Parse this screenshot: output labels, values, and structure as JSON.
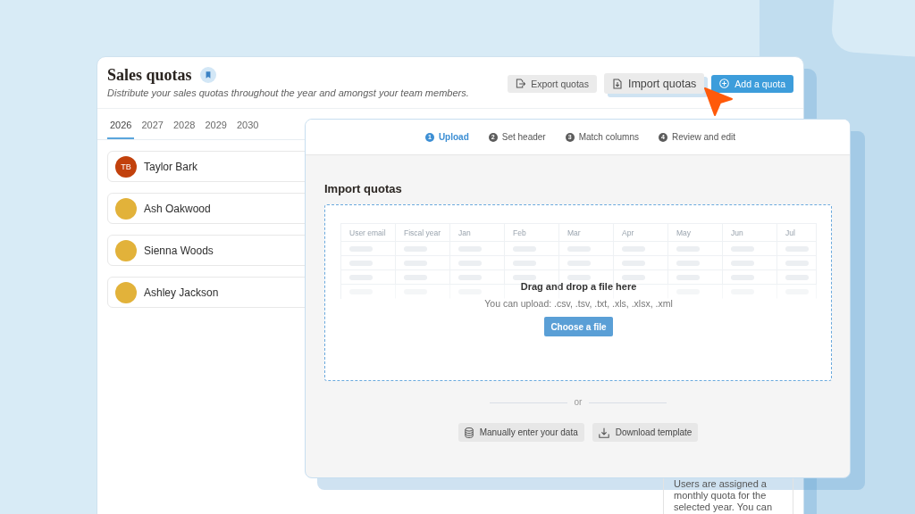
{
  "page": {
    "title": "Sales quotas",
    "subtitle": "Distribute your sales quotas throughout the year and amongst your team members."
  },
  "header_buttons": [
    {
      "label": "Export quotas",
      "kind": "export",
      "hovered": false
    },
    {
      "label": "Import quotas",
      "kind": "import",
      "hovered": true
    },
    {
      "label": "Add a quota",
      "kind": "add",
      "hovered": false
    }
  ],
  "year_tabs": [
    {
      "label": "2026",
      "selected": true
    },
    {
      "label": "2027",
      "selected": false
    },
    {
      "label": "2028",
      "selected": false
    },
    {
      "label": "2029",
      "selected": false
    },
    {
      "label": "2030",
      "selected": false
    }
  ],
  "members": [
    {
      "name": "Taylor Bark",
      "avatar": {
        "kind": "initials",
        "initials": "TB"
      }
    },
    {
      "name": "Ash Oakwood",
      "avatar": {
        "kind": "photo"
      }
    },
    {
      "name": "Sienna Woods",
      "avatar": {
        "kind": "photo"
      }
    },
    {
      "name": "Ashley Jackson",
      "avatar": {
        "kind": "photo"
      }
    }
  ],
  "help_panel": {
    "text": "Users are assigned a monthly quota for the selected year. You can"
  },
  "import_dialog": {
    "steps": [
      {
        "number": "1",
        "label": "Upload",
        "selected": true
      },
      {
        "number": "2",
        "label": "Set header",
        "selected": false
      },
      {
        "number": "3",
        "label": "Match columns",
        "selected": false
      },
      {
        "number": "4",
        "label": "Review and edit",
        "selected": false
      }
    ],
    "title": "Import quotas",
    "dropzone": {
      "preview_columns": [
        "User email",
        "Fiscal year",
        "Jan",
        "Feb",
        "Mar",
        "Apr",
        "May",
        "Jun",
        "Jul"
      ],
      "heading": "Drag and drop a file here",
      "hint": "You can upload: .csv, .tsv, .txt, .xls, .xlsx, .xml",
      "button": "Choose a file"
    },
    "divider": "or",
    "actions": [
      {
        "label": "Manually enter your data",
        "kind": "manual"
      },
      {
        "label": "Download template",
        "kind": "download"
      }
    ]
  }
}
